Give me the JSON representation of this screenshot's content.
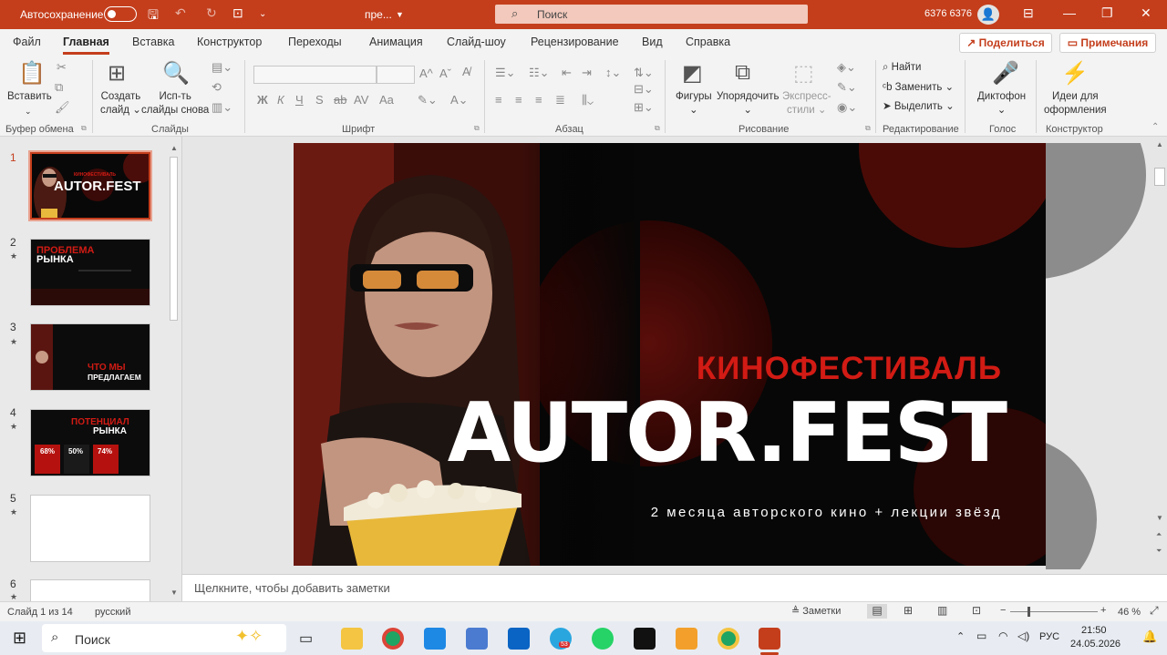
{
  "titlebar": {
    "autosave_label": "Автосохранение",
    "doc_name": "пре...",
    "search_placeholder": "Поиск",
    "user_name": "6376 6376"
  },
  "menu": {
    "items": [
      "Файл",
      "Главная",
      "Вставка",
      "Конструктор",
      "Переходы",
      "Анимация",
      "Слайд-шоу",
      "Рецензирование",
      "Вид",
      "Справка"
    ],
    "active": "Главная",
    "share_label": "Поделиться",
    "comments_label": "Примечания"
  },
  "ribbon": {
    "paste": "Вставить",
    "new_slide_1": "Создать",
    "new_slide_2": "слайд",
    "reuse_1": "Исп-ть",
    "reuse_2": "слайды снова",
    "shapes": "Фигуры",
    "arrange": "Упорядочить",
    "quick_styles_1": "Экспресс-",
    "quick_styles_2": "стили",
    "find": "Найти",
    "replace": "Заменить",
    "select": "Выделить",
    "dictate": "Диктофон",
    "designer_1": "Идеи для",
    "designer_2": "оформления",
    "groups": {
      "clipboard": "Буфер обмена",
      "slides": "Слайды",
      "font": "Шрифт",
      "paragraph": "Абзац",
      "drawing": "Рисование",
      "editing": "Редактирование",
      "voice": "Голос",
      "designer": "Конструктор"
    },
    "font_buttons": [
      "Ж",
      "К",
      "Ч",
      "S",
      "ab",
      "AV",
      "Aa"
    ]
  },
  "thumbnails": [
    {
      "num": "1",
      "title_small": "КИНОФЕСТИВАЛЬ",
      "title_big": "AUTOR.FEST",
      "starred": false
    },
    {
      "num": "2",
      "title_small": "ПРОБЛЕМА",
      "title_big": "РЫНКА",
      "starred": true
    },
    {
      "num": "3",
      "title_small": "ЧТО МЫ",
      "title_big": "ПРЕДЛАГАЕМ",
      "starred": true
    },
    {
      "num": "4",
      "title_small": "ПОТЕНЦИАЛ",
      "title_big": "РЫНКА",
      "starred": true,
      "stats": [
        "68%",
        "50%",
        "74%"
      ]
    },
    {
      "num": "5",
      "starred": true
    },
    {
      "num": "6",
      "starred": true
    }
  ],
  "slide": {
    "kicker": "КИНОФЕСТИВАЛЬ",
    "title": "AUTOR.FEST",
    "subtitle": "2 месяца авторского кино + лекции звёзд",
    "accent_color": "#d11b14"
  },
  "notes_placeholder": "Щелкните, чтобы добавить заметки",
  "status": {
    "slide_counter": "Слайд 1 из 14",
    "language": "русский",
    "notes_button": "Заметки",
    "zoom": "46 %"
  },
  "taskbar": {
    "search_label": "Поиск",
    "tray_lang": "РУС",
    "time": "21:50",
    "date": "24.05.2026",
    "telegram_badge": "53"
  }
}
